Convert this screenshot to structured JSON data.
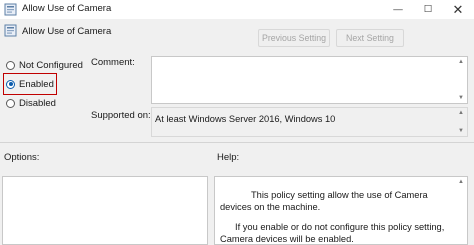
{
  "window": {
    "title": "Allow Use of Camera",
    "controls": {
      "minimize": "—",
      "maximize": "☐",
      "close": "✕"
    }
  },
  "header": {
    "policy_name": "Allow Use of Camera",
    "previous_label": "Previous Setting",
    "next_label": "Next Setting"
  },
  "state": {
    "options": [
      {
        "label": "Not Configured",
        "checked": false
      },
      {
        "label": "Enabled",
        "checked": true
      },
      {
        "label": "Disabled",
        "checked": false
      }
    ]
  },
  "comment": {
    "label": "Comment:",
    "value": ""
  },
  "supported": {
    "label": "Supported on:",
    "value": "At least Windows Server 2016, Windows 10"
  },
  "options_section": {
    "label": "Options:"
  },
  "help_section": {
    "label": "Help:",
    "paragraph1": "This policy setting allow the use of Camera devices on the machine.",
    "paragraph2": "If you enable or do not configure this policy setting, Camera devices will be enabled."
  },
  "colors": {
    "selection_highlight": "#c00000",
    "radio_accent": "#0b5cad"
  }
}
